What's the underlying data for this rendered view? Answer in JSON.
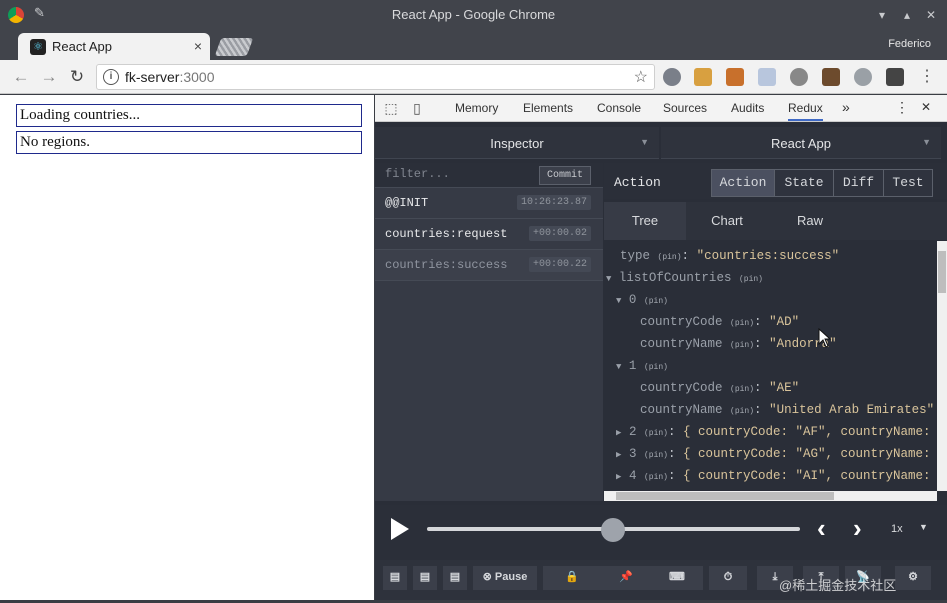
{
  "window": {
    "title": "React App - Google Chrome",
    "controls": [
      "▾",
      "▴",
      "✕"
    ]
  },
  "tab": {
    "title": "React App",
    "close": "×",
    "user": "Federico"
  },
  "toolbar": {
    "url_host": "fk-server",
    "url_port": ":3000"
  },
  "page": {
    "loading_text": "Loading countries...",
    "regions_text": "No regions."
  },
  "devtools": {
    "tabs": [
      "Memory",
      "Elements",
      "Console",
      "Sources",
      "Audits",
      "Redux"
    ],
    "active_tab": "Redux",
    "more": "»",
    "menu": "⋮",
    "close": "✕"
  },
  "redux": {
    "monitor": "Inspector",
    "instance": "React App",
    "filter_placeholder": "filter...",
    "commit_label": "Commit",
    "actions": [
      {
        "name": "@@INIT",
        "time": "10:26:23.87"
      },
      {
        "name": "countries:request",
        "time": "+00:00.02"
      },
      {
        "name": "countries:success",
        "time": "+00:00.22"
      }
    ],
    "panel_label": "Action",
    "panel_tabs": [
      "Action",
      "State",
      "Diff",
      "Test"
    ],
    "sub_tabs": [
      "Tree",
      "Chart",
      "Raw"
    ],
    "tree": {
      "type_key": "type",
      "type_value": "\"countries:success\"",
      "list_key": "listOfCountries",
      "pin": "(pin)",
      "items": [
        {
          "index": "0",
          "code_key": "countryCode",
          "code": "\"AD\"",
          "name_key": "countryName",
          "name": "\"Andorra\""
        },
        {
          "index": "1",
          "code_key": "countryCode",
          "code": "\"AE\"",
          "name_key": "countryName",
          "name": "\"United Arab Emirates\""
        }
      ],
      "collapsed": [
        {
          "index": "2",
          "preview": "{ countryCode: \"AF\", countryName: \""
        },
        {
          "index": "3",
          "preview": "{ countryCode: \"AG\", countryName: \""
        },
        {
          "index": "4",
          "preview": "{ countryCode: \"AI\", countryName: \""
        }
      ]
    },
    "speed": "1x",
    "buttons": {
      "pause": "Pause"
    }
  },
  "watermark": "@稀土掘金技术社区"
}
